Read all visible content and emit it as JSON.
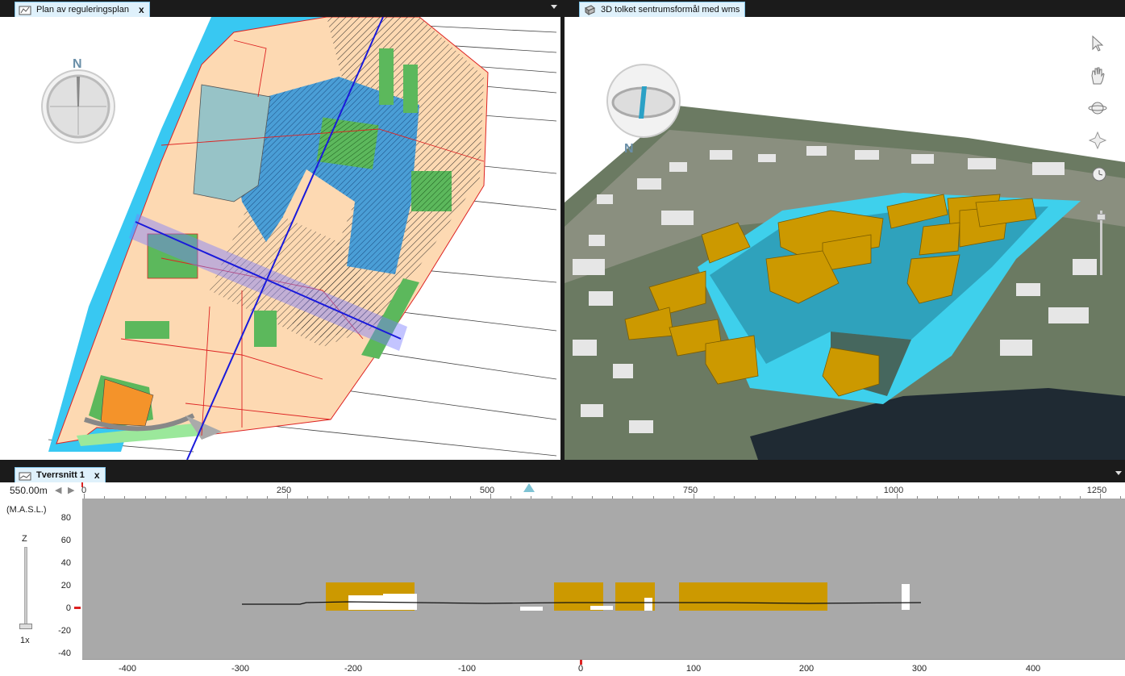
{
  "left_panel": {
    "tab_title": "Plan av reguleringsplan",
    "tab_close": "x",
    "compass_label": "N"
  },
  "right_panel": {
    "tab_title": "3D tolket sentrumsformål med wms",
    "compass_label": "N",
    "tools": [
      "pointer-icon",
      "hand-pan-icon",
      "orbit-icon",
      "fly-icon",
      "clock-icon"
    ]
  },
  "bottom_panel": {
    "tab_title": "Tverrsnitt 1",
    "tab_close": "x",
    "distance": "550.00m",
    "ruler_labels": [
      "0",
      "250",
      "500",
      "750",
      "1000",
      "1250"
    ],
    "y_unit": "(M.A.S.L.)",
    "z_label": "Z",
    "zoom_label": "1x",
    "y_labels": [
      "80",
      "60",
      "40",
      "20",
      "0",
      "-20",
      "-40"
    ],
    "x_labels": [
      "-400",
      "-300",
      "-200",
      "-100",
      "0",
      "100",
      "200",
      "300",
      "400"
    ]
  },
  "colors": {
    "water": "#38c8f2",
    "plan_fill": "#fdd9b2",
    "green_zone": "#5cb85c",
    "building": "#cc9900",
    "section_bg": "#a9a9a9",
    "tab_bg": "#dff1fb"
  }
}
